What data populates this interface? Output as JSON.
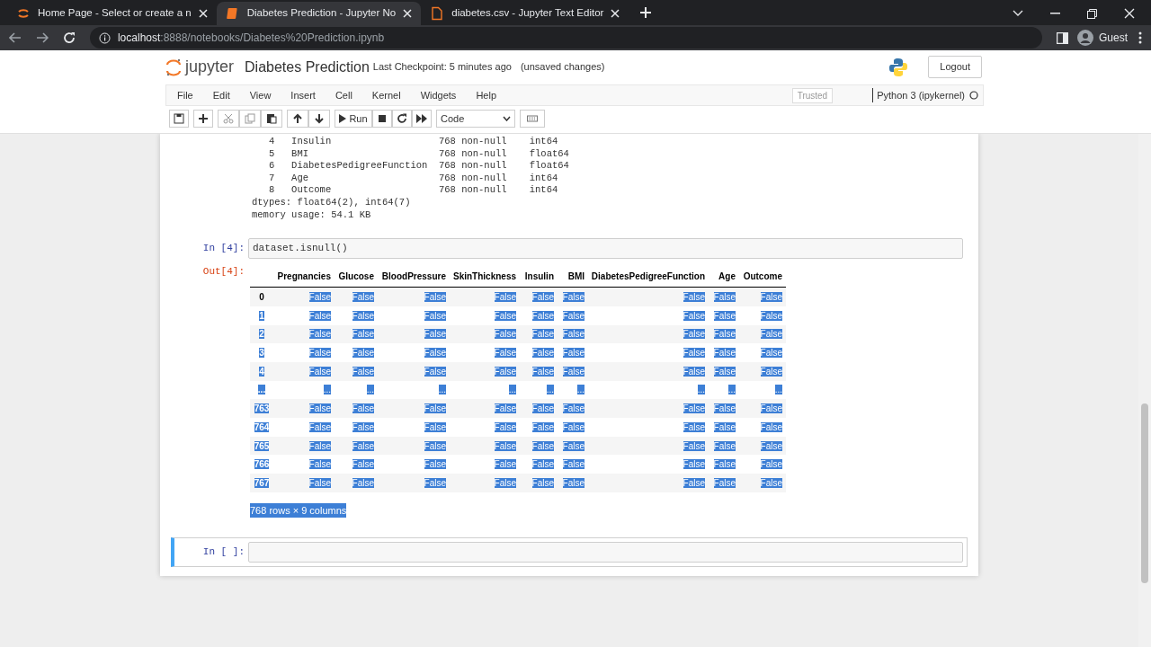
{
  "browser": {
    "tabs": [
      {
        "title": "Home Page - Select or create a n",
        "selected": false
      },
      {
        "title": "Diabetes Prediction - Jupyter No",
        "selected": true
      },
      {
        "title": "diabetes.csv - Jupyter Text Editor",
        "selected": false
      }
    ],
    "address": {
      "host": "localhost",
      "path": ":8888/notebooks/Diabetes%20Prediction.ipynb"
    },
    "profile": "Guest"
  },
  "header": {
    "logo": "jupyter",
    "notebook_name": "Diabetes Prediction",
    "checkpoint": "Last Checkpoint: 5 minutes ago",
    "save_status": "(unsaved changes)",
    "logout": "Logout"
  },
  "menu": [
    "File",
    "Edit",
    "View",
    "Insert",
    "Cell",
    "Kernel",
    "Widgets",
    "Help"
  ],
  "trusted": "Trusted",
  "kernel": "Python 3 (ipykernel)",
  "toolbar": {
    "run": "Run",
    "cell_type": "Code"
  },
  "info_output": [
    "   4   Insulin                   768 non-null    int64  ",
    "   5   BMI                       768 non-null    float64",
    "   6   DiabetesPedigreeFunction  768 non-null    float64",
    "   7   Age                       768 non-null    int64  ",
    "   8   Outcome                   768 non-null    int64  ",
    "dtypes: float64(2), int64(7)",
    "memory usage: 54.1 KB"
  ],
  "cells": [
    {
      "prompt": "In [4]:",
      "source": "dataset.isnull()",
      "selected": false,
      "out_prompt": "Out[4]:",
      "table": {
        "columns": [
          "Pregnancies",
          "Glucose",
          "BloodPressure",
          "SkinThickness",
          "Insulin",
          "BMI",
          "DiabetesPedigreeFunction",
          "Age",
          "Outcome"
        ],
        "rows": [
          {
            "index": "0",
            "index_highlighted": false,
            "cells": [
              "False",
              "False",
              "False",
              "False",
              "False",
              "False",
              "False",
              "False",
              "False"
            ]
          },
          {
            "index": "1",
            "index_highlighted": true,
            "cells": [
              "False",
              "False",
              "False",
              "False",
              "False",
              "False",
              "False",
              "False",
              "False"
            ]
          },
          {
            "index": "2",
            "index_highlighted": true,
            "cells": [
              "False",
              "False",
              "False",
              "False",
              "False",
              "False",
              "False",
              "False",
              "False"
            ]
          },
          {
            "index": "3",
            "index_highlighted": true,
            "cells": [
              "False",
              "False",
              "False",
              "False",
              "False",
              "False",
              "False",
              "False",
              "False"
            ]
          },
          {
            "index": "4",
            "index_highlighted": true,
            "cells": [
              "False",
              "False",
              "False",
              "False",
              "False",
              "False",
              "False",
              "False",
              "False"
            ]
          },
          {
            "index": "...",
            "index_highlighted": true,
            "cells": [
              "...",
              "...",
              "...",
              "...",
              "...",
              "...",
              "...",
              "...",
              "..."
            ]
          },
          {
            "index": "763",
            "index_highlighted": true,
            "cells": [
              "False",
              "False",
              "False",
              "False",
              "False",
              "False",
              "False",
              "False",
              "False"
            ]
          },
          {
            "index": "764",
            "index_highlighted": true,
            "cells": [
              "False",
              "False",
              "False",
              "False",
              "False",
              "False",
              "False",
              "False",
              "False"
            ]
          },
          {
            "index": "765",
            "index_highlighted": true,
            "cells": [
              "False",
              "False",
              "False",
              "False",
              "False",
              "False",
              "False",
              "False",
              "False"
            ]
          },
          {
            "index": "766",
            "index_highlighted": true,
            "cells": [
              "False",
              "False",
              "False",
              "False",
              "False",
              "False",
              "False",
              "False",
              "False"
            ]
          },
          {
            "index": "767",
            "index_highlighted": true,
            "cells": [
              "False",
              "False",
              "False",
              "False",
              "False",
              "False",
              "False",
              "False",
              "False"
            ]
          }
        ],
        "cells_highlighted": true,
        "footer": "768 rows × 9 columns",
        "footer_highlighted": true
      }
    },
    {
      "prompt": "In [ ]:",
      "selected": true
    }
  ]
}
